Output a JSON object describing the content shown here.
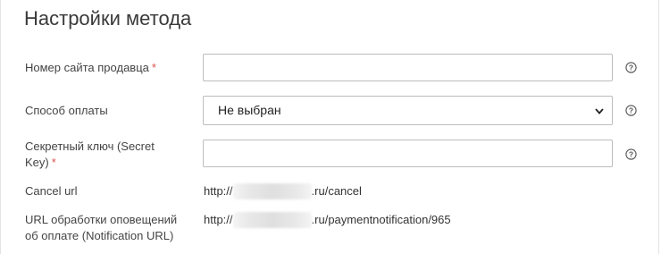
{
  "page": {
    "title": "Настройки метода"
  },
  "fields": {
    "seller_site_number": {
      "label": "Номер сайта продавца",
      "required_mark": "*",
      "value": ""
    },
    "payment_method": {
      "label": "Способ оплаты",
      "selected": "Не выбран"
    },
    "secret_key": {
      "label": "Секретный ключ (Secret Key)",
      "required_mark": "*",
      "value": ""
    },
    "cancel_url": {
      "label": "Cancel url",
      "prefix": "http://",
      "suffix": ".ru/cancel"
    },
    "notification_url": {
      "label": "URL обработки оповещений об оплате (Notification URL)",
      "prefix": "http://",
      "suffix": ".ru/paymentnotification/965"
    }
  },
  "icons": {
    "help": "question-circle-icon",
    "dropdown": "chevron-down-icon"
  },
  "colors": {
    "required": "#d9534f",
    "border": "#bdbdbd"
  }
}
